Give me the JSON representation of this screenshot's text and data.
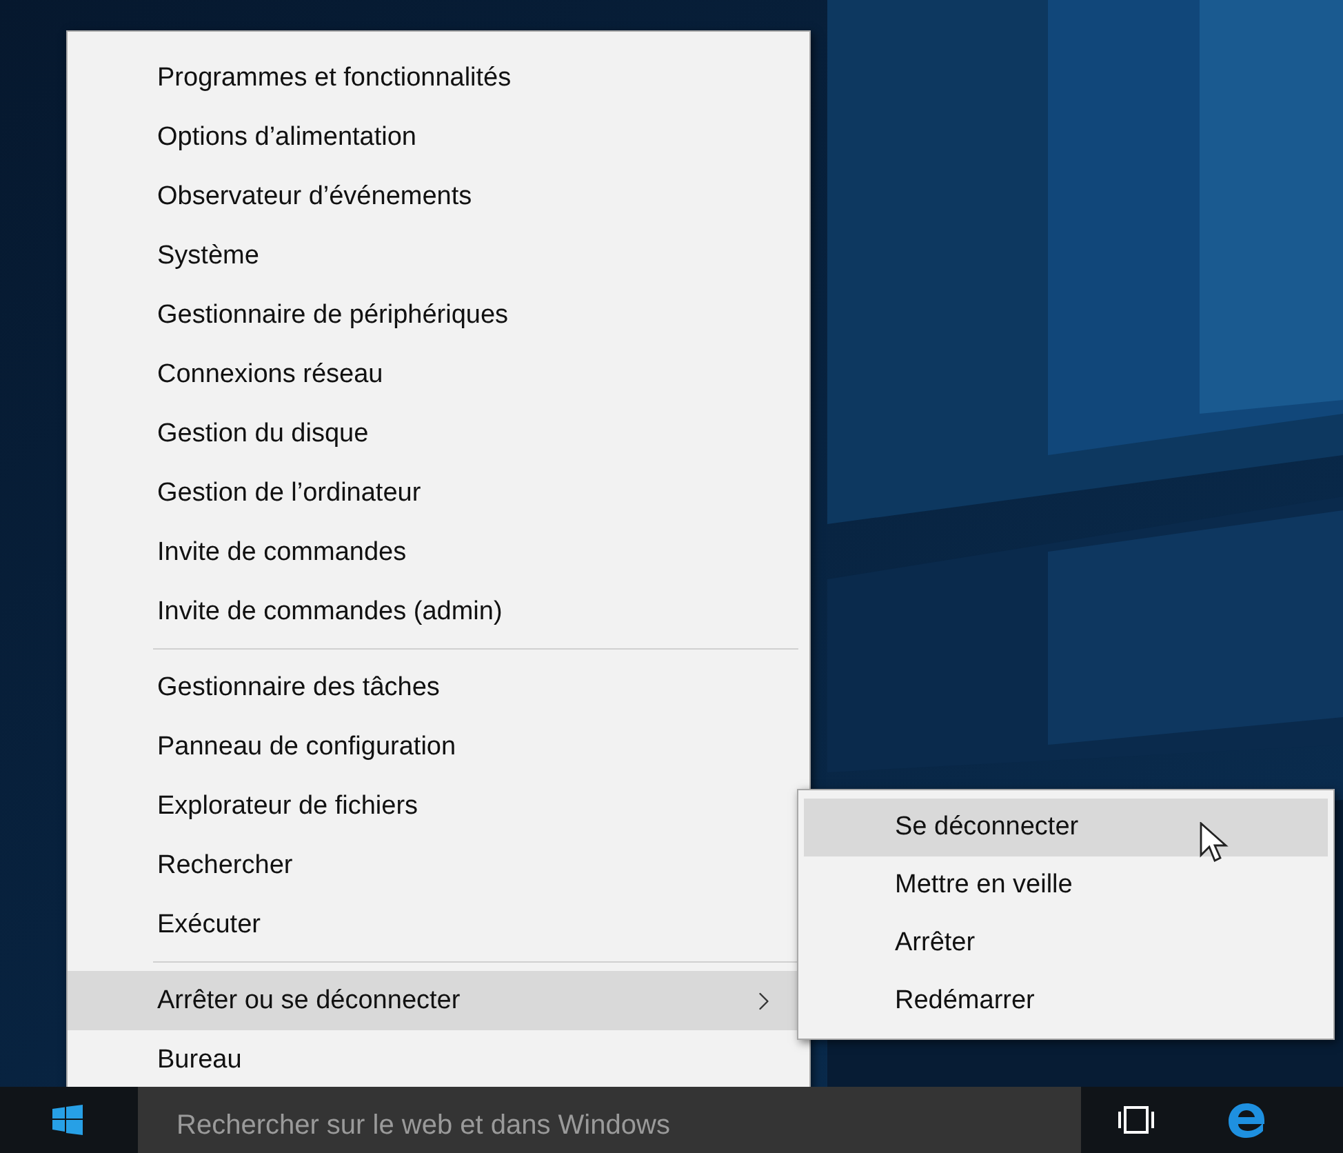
{
  "context_menu": {
    "groups": [
      [
        {
          "label": "Programmes et fonctionnalités",
          "selected": false,
          "has_submenu": false
        },
        {
          "label": "Options d’alimentation",
          "selected": false,
          "has_submenu": false
        },
        {
          "label": "Observateur d’événements",
          "selected": false,
          "has_submenu": false
        },
        {
          "label": "Système",
          "selected": false,
          "has_submenu": false
        },
        {
          "label": "Gestionnaire de périphériques",
          "selected": false,
          "has_submenu": false
        },
        {
          "label": "Connexions réseau",
          "selected": false,
          "has_submenu": false
        },
        {
          "label": "Gestion du disque",
          "selected": false,
          "has_submenu": false
        },
        {
          "label": "Gestion de l’ordinateur",
          "selected": false,
          "has_submenu": false
        },
        {
          "label": "Invite de commandes",
          "selected": false,
          "has_submenu": false
        },
        {
          "label": "Invite de commandes (admin)",
          "selected": false,
          "has_submenu": false
        }
      ],
      [
        {
          "label": "Gestionnaire des tâches",
          "selected": false,
          "has_submenu": false
        },
        {
          "label": "Panneau de configuration",
          "selected": false,
          "has_submenu": false
        },
        {
          "label": "Explorateur de fichiers",
          "selected": false,
          "has_submenu": false
        },
        {
          "label": "Rechercher",
          "selected": false,
          "has_submenu": false
        },
        {
          "label": "Exécuter",
          "selected": false,
          "has_submenu": false
        }
      ],
      [
        {
          "label": "Arrêter ou se déconnecter",
          "selected": true,
          "has_submenu": true
        },
        {
          "label": "Bureau",
          "selected": false,
          "has_submenu": false
        }
      ]
    ]
  },
  "submenu": {
    "items": [
      {
        "label": "Se déconnecter",
        "selected": true
      },
      {
        "label": "Mettre en veille",
        "selected": false
      },
      {
        "label": "Arrêter",
        "selected": false
      },
      {
        "label": "Redémarrer",
        "selected": false
      }
    ]
  },
  "taskbar": {
    "search": {
      "placeholder": "Rechercher sur le web et dans Windows"
    }
  }
}
